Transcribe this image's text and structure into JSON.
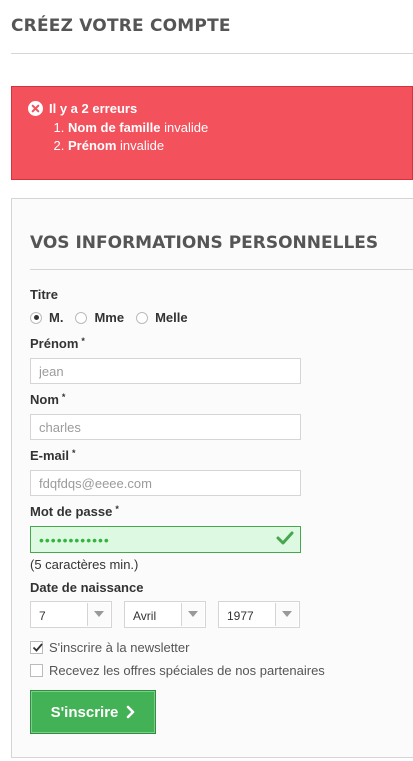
{
  "page": {
    "title": "CRÉEZ VOTRE COMPTE"
  },
  "alert": {
    "heading": "Il y a 2 erreurs",
    "errors": [
      {
        "field": "Nom de famille",
        "message": "invalide"
      },
      {
        "field": "Prénom",
        "message": "invalide"
      }
    ]
  },
  "form": {
    "section_title": "VOS INFORMATIONS PERSONNELLES",
    "titre_label": "Titre",
    "title_options": [
      "M.",
      "Mme",
      "Melle"
    ],
    "title_selected": "M.",
    "prenom_label": "Prénom",
    "prenom_value": "jean",
    "nom_label": "Nom",
    "nom_value": "charles",
    "email_label": "E-mail",
    "email_value": "fdqfdqs@eeee.com",
    "password_label": "Mot de passe",
    "password_mask": "••••••••••••",
    "password_hint": "(5 caractères min.)",
    "birthdate_label": "Date de naissance",
    "birth_day": "7",
    "birth_month": "Avril",
    "birth_year": "1977",
    "required_marker": "*",
    "newsletter_label": "S'inscrire à la newsletter",
    "newsletter_checked": true,
    "offers_label": "Recevez les offres spéciales de nos partenaires",
    "offers_checked": false,
    "submit_label": "S'inscrire"
  },
  "colors": {
    "error_bg": "#f3515c",
    "success_green": "#43b155",
    "valid_field_bg": "#ddf9e1"
  }
}
